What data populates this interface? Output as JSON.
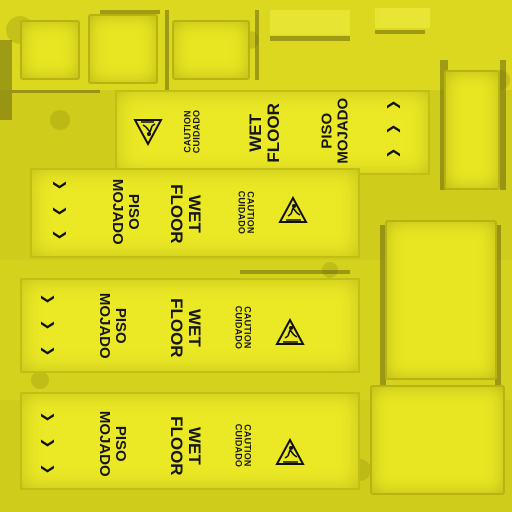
{
  "sign": {
    "caution_text": "CAUTION\nCUIDADO",
    "english_text": "WET\nFLOOR",
    "spanish_text": "PISO\nMOJADO",
    "chevron_glyph": "❯"
  },
  "colors": {
    "sign_yellow": "#e8e622",
    "dark_yellow": "#c9c71a",
    "ink": "#161616"
  },
  "icons": {
    "warning": "slippery-floor-warning-icon",
    "arrows": "chevron-icon"
  }
}
